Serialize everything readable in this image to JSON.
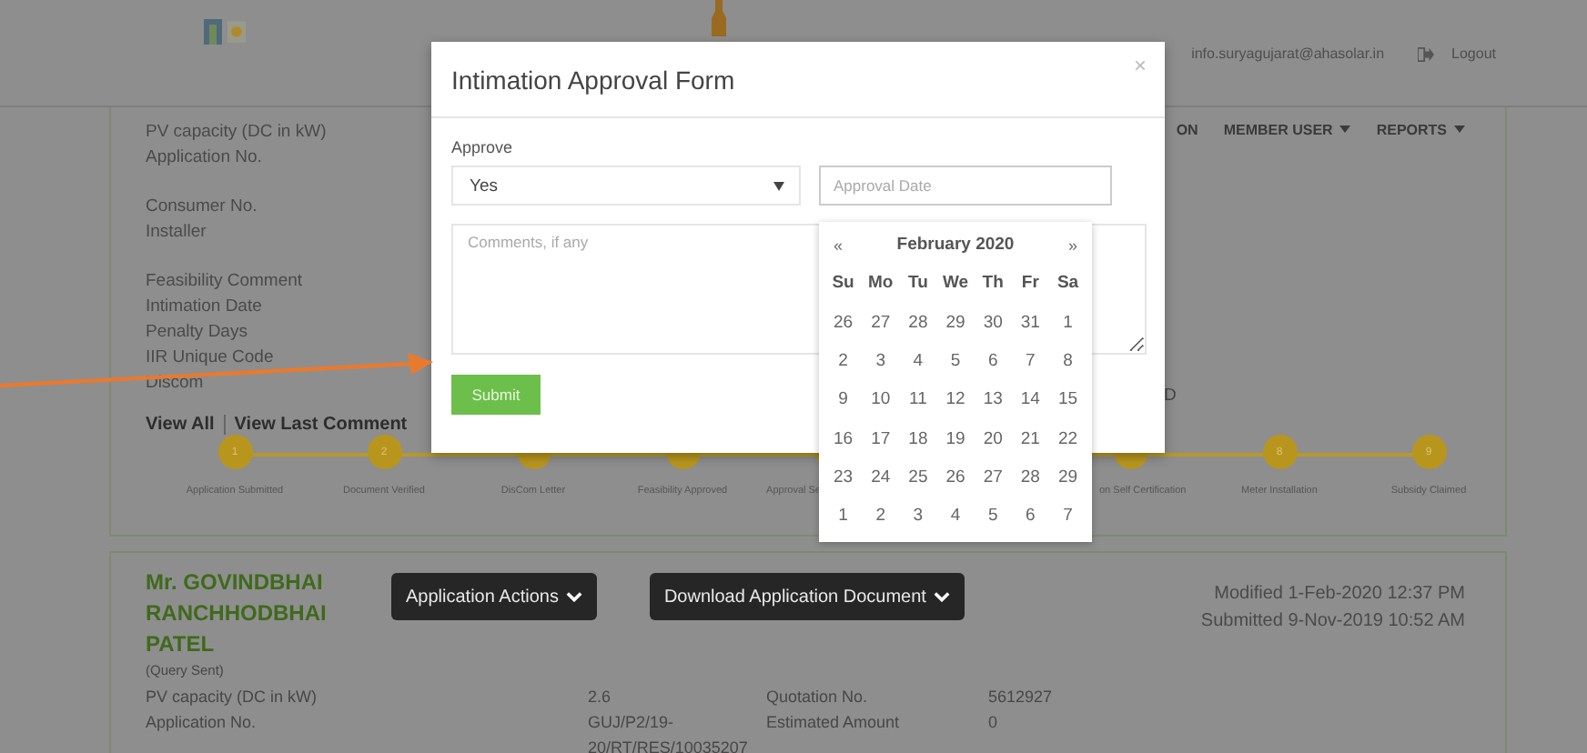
{
  "header": {
    "email": "info.suryagujarat@ahasolar.in",
    "logout": "Logout"
  },
  "nav": [
    {
      "label": "ON",
      "dropdown": false
    },
    {
      "label": "MEMBER USER",
      "dropdown": true
    },
    {
      "label": "REPORTS",
      "dropdown": true
    }
  ],
  "application_card": {
    "field_groups": [
      [
        "PV capacity (DC in kW)",
        "Application No."
      ],
      [
        "Consumer No.",
        "Installer"
      ],
      [
        "Feasibility Comment",
        "Intimation Date",
        "Penalty Days",
        "IIR Unique Code",
        "Discom"
      ]
    ],
    "partial_value": "D",
    "links": [
      "View All",
      "View Last Comment"
    ],
    "steps": [
      {
        "number": "1",
        "label": "Application Submitted"
      },
      {
        "number": "2",
        "label": "Document Verified"
      },
      {
        "label": "DisCom Letter"
      },
      {
        "label": "Feasibility Approved"
      },
      {
        "label": "Approval Se"
      },
      {
        "label": "on Self Certification"
      },
      {
        "number": "8",
        "label": "Meter Installation"
      },
      {
        "number": "9",
        "label": "Subsidy Claimed"
      }
    ]
  },
  "second_card": {
    "name": "Mr. GOVINDBHAI RANCHHODBHAI PATEL",
    "actions": [
      "Application Actions",
      "Download Application Document"
    ],
    "modified": "Modified 1-Feb-2020 12:37 PM",
    "submitted": "Submitted 9-Nov-2019 10:52 AM",
    "status": "(Query Sent)",
    "details": [
      {
        "label": "PV capacity (DC in kW)",
        "value": "2.6"
      },
      {
        "label": "Application No.",
        "value": "GUJ/P2/19-20/RT/RES/10035207"
      }
    ],
    "details_right": [
      {
        "label": "Quotation No.",
        "value": "5612927"
      },
      {
        "label": "Estimated Amount",
        "value": "0"
      }
    ]
  },
  "modal": {
    "title": "Intimation Approval Form",
    "close": "×",
    "approve_label": "Approve",
    "approve_value": "Yes",
    "date_placeholder": "Approval Date",
    "comments_placeholder": "Comments, if any",
    "submit": "Submit"
  },
  "calendar": {
    "prev": "«",
    "month": "February 2020",
    "next": "»",
    "weekdays": [
      "Su",
      "Mo",
      "Tu",
      "We",
      "Th",
      "Fr",
      "Sa"
    ],
    "weeks": [
      [
        "26",
        "27",
        "28",
        "29",
        "30",
        "31",
        "1"
      ],
      [
        "2",
        "3",
        "4",
        "5",
        "6",
        "7",
        "8"
      ],
      [
        "9",
        "10",
        "11",
        "12",
        "13",
        "14",
        "15"
      ],
      [
        "16",
        "17",
        "18",
        "19",
        "20",
        "21",
        "22"
      ],
      [
        "23",
        "24",
        "25",
        "26",
        "27",
        "28",
        "29"
      ],
      [
        "1",
        "2",
        "3",
        "4",
        "5",
        "6",
        "7"
      ]
    ]
  }
}
